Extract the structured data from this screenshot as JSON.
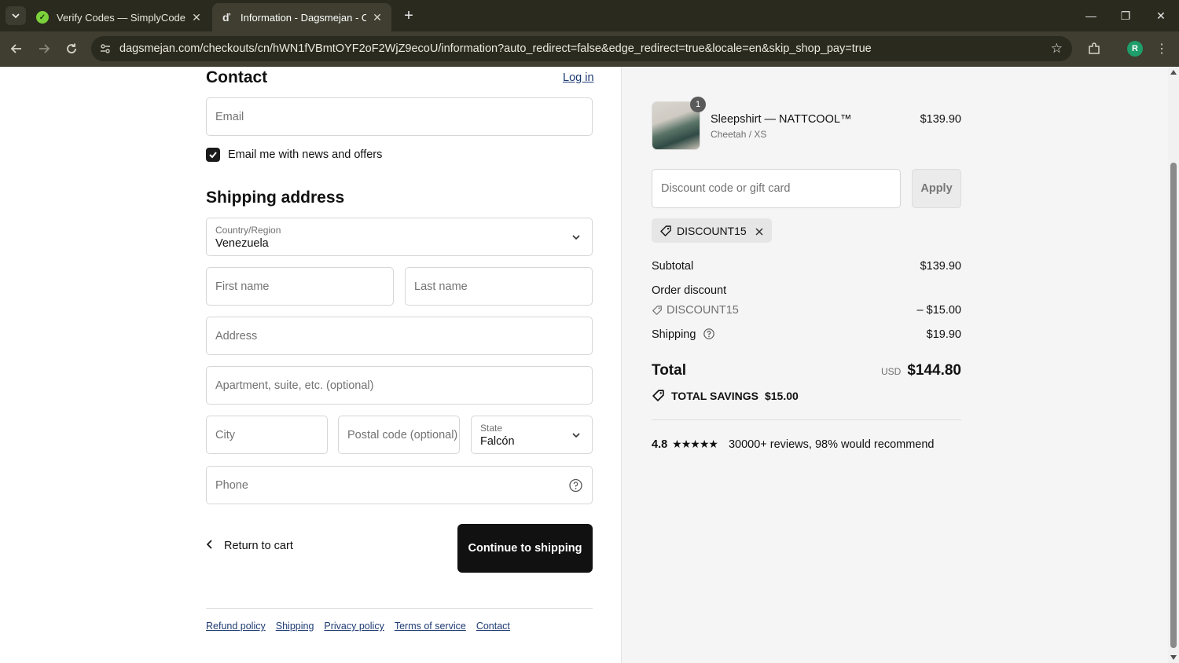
{
  "browser": {
    "tabs": [
      {
        "title": "Verify Codes — SimplyCodes",
        "active": false
      },
      {
        "title": "Information - Dagsmejan - Checkout",
        "active": true
      }
    ],
    "url": "dagsmejan.com/checkouts/cn/hWN1fVBmtOYF2oF2WjZ9ecoU/information?auto_redirect=false&edge_redirect=true&locale=en&skip_shop_pay=true",
    "avatar_letter": "R"
  },
  "contact": {
    "heading": "Contact",
    "login_label": "Log in",
    "email_placeholder": "Email",
    "newsletter_label": "Email me with news and offers",
    "newsletter_checked": true
  },
  "shipping": {
    "heading": "Shipping address",
    "country_label": "Country/Region",
    "country_value": "Venezuela",
    "first_name_placeholder": "First name",
    "last_name_placeholder": "Last name",
    "address_placeholder": "Address",
    "apartment_placeholder": "Apartment, suite, etc. (optional)",
    "city_placeholder": "City",
    "postal_placeholder": "Postal code (optional)",
    "state_label": "State",
    "state_value": "Falcón",
    "phone_placeholder": "Phone"
  },
  "actions": {
    "return_label": "Return to cart",
    "continue_label": "Continue to shipping"
  },
  "footer": {
    "links": [
      "Refund policy",
      "Shipping",
      "Privacy policy",
      "Terms of service",
      "Contact"
    ]
  },
  "summary": {
    "product": {
      "quantity": "1",
      "name": "Sleepshirt — NATTCOOL™",
      "variant": "Cheetah / XS",
      "price": "$139.90"
    },
    "discount_placeholder": "Discount code or gift card",
    "apply_label": "Apply",
    "applied_code": "DISCOUNT15",
    "subtotal_label": "Subtotal",
    "subtotal_value": "$139.90",
    "order_discount_label": "Order discount",
    "order_discount_code": "DISCOUNT15",
    "order_discount_value": "– $15.00",
    "shipping_label": "Shipping",
    "shipping_value": "$19.90",
    "total_label": "Total",
    "total_currency": "USD",
    "total_value": "$144.80",
    "savings_label": "TOTAL SAVINGS",
    "savings_value": "$15.00",
    "rating": "4.8",
    "stars": "★★★★★",
    "reviews_text": "30000+ reviews, 98% would recommend"
  }
}
